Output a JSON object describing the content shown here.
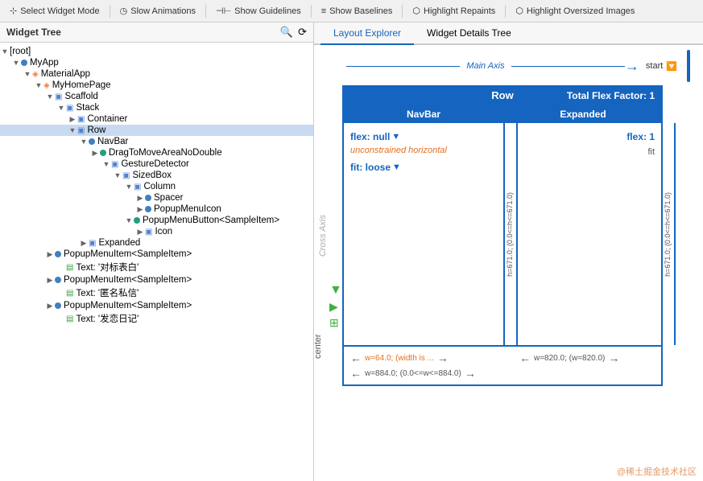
{
  "toolbar": {
    "buttons": [
      {
        "id": "select-widget",
        "icon": "⊹",
        "label": "Select Widget Mode"
      },
      {
        "id": "slow-animations",
        "icon": "◷",
        "label": "Slow Animations"
      },
      {
        "id": "show-guidelines",
        "icon": "⊞",
        "label": "Show Guidelines"
      },
      {
        "id": "show-baselines",
        "icon": "≡",
        "label": "Show Baselines"
      },
      {
        "id": "highlight-repaints",
        "icon": "⬡",
        "label": "Highlight Repaints"
      },
      {
        "id": "highlight-oversized",
        "icon": "⬡",
        "label": "Highlight Oversized Images"
      }
    ]
  },
  "widget_tree": {
    "title": "Widget Tree",
    "search_icon": "🔍",
    "refresh_icon": "⟳",
    "items": [
      {
        "id": "root",
        "label": "[root]",
        "indent": 0,
        "toggle": "▼",
        "icon_type": "none"
      },
      {
        "id": "myapp",
        "label": "MyApp",
        "indent": 1,
        "toggle": "▼",
        "icon_type": "circle-blue"
      },
      {
        "id": "materialapp",
        "label": "MaterialApp",
        "indent": 2,
        "toggle": "▼",
        "icon_type": "material"
      },
      {
        "id": "myhomepage",
        "label": "MyHomePage",
        "indent": 3,
        "toggle": "▼",
        "icon_type": "material"
      },
      {
        "id": "scaffold",
        "label": "Scaffold",
        "indent": 4,
        "toggle": "▼",
        "icon_type": "widget"
      },
      {
        "id": "stack",
        "label": "Stack",
        "indent": 5,
        "toggle": "▼",
        "icon_type": "widget"
      },
      {
        "id": "container",
        "label": "Container",
        "indent": 6,
        "toggle": "▶",
        "icon_type": "widget"
      },
      {
        "id": "row",
        "label": "Row",
        "indent": 6,
        "toggle": "▼",
        "icon_type": "widget",
        "selected": true
      },
      {
        "id": "navbar",
        "label": "NavBar",
        "indent": 7,
        "toggle": "▼",
        "icon_type": "circle-blue"
      },
      {
        "id": "dragtomove",
        "label": "DragToMoveAreaNoDouble",
        "indent": 8,
        "toggle": "▶",
        "icon_type": "circle-teal"
      },
      {
        "id": "gesturedetector",
        "label": "GestureDetector",
        "indent": 9,
        "toggle": "▼",
        "icon_type": "widget"
      },
      {
        "id": "sizedbox",
        "label": "SizedBox",
        "indent": 10,
        "toggle": "▼",
        "icon_type": "widget"
      },
      {
        "id": "column",
        "label": "Column",
        "indent": 11,
        "toggle": "▼",
        "icon_type": "widget"
      },
      {
        "id": "spacer",
        "label": "Spacer",
        "indent": 12,
        "toggle": "▶",
        "icon_type": "circle-blue"
      },
      {
        "id": "popupmenuicon",
        "label": "PopupMenuIcon",
        "indent": 12,
        "toggle": "▶",
        "icon_type": "circle-blue"
      },
      {
        "id": "popupmenubutton",
        "label": "PopupMenuButton<SampleItem>",
        "indent": 11,
        "toggle": "▼",
        "icon_type": "circle-teal"
      },
      {
        "id": "icon",
        "label": "Icon",
        "indent": 12,
        "toggle": "▶",
        "icon_type": "widget"
      },
      {
        "id": "expanded",
        "label": "Expanded",
        "indent": 7,
        "toggle": "▶",
        "icon_type": "widget"
      },
      {
        "id": "popupmenuitem1",
        "label": "PopupMenuItem<SampleItem>",
        "indent": 4,
        "toggle": "▶",
        "icon_type": "circle-blue"
      },
      {
        "id": "text1",
        "label": "Text: '对标表白'",
        "indent": 5,
        "toggle": "",
        "icon_type": "text"
      },
      {
        "id": "popupmenuitem2",
        "label": "PopupMenuItem<SampleItem>",
        "indent": 4,
        "toggle": "▶",
        "icon_type": "circle-blue"
      },
      {
        "id": "text2",
        "label": "Text: '匿名私信'",
        "indent": 5,
        "toggle": "",
        "icon_type": "text"
      },
      {
        "id": "popupmenuitem3",
        "label": "PopupMenuItem<SampleItem>",
        "indent": 4,
        "toggle": "▶",
        "icon_type": "circle-blue"
      },
      {
        "id": "text3",
        "label": "Text: '发恋日记'",
        "indent": 5,
        "toggle": "",
        "icon_type": "text"
      }
    ]
  },
  "layout_explorer": {
    "tab_label": "Layout Explorer",
    "widget_details_tab": "Widget Details Tree",
    "main_axis_label": "Main Axis",
    "main_axis_start": "start",
    "cross_axis_label": "Cross Axis",
    "center_label": "center",
    "row_label": "Row",
    "total_flex_label": "Total Flex Factor: 1",
    "navbar_label": "NavBar",
    "expanded_label": "Expanded",
    "navbar_flex": "flex: null",
    "navbar_unconstrained": "unconstrained horizontal",
    "navbar_fit": "fit: loose",
    "expanded_flex": "flex: 1",
    "expanded_fit": "fit",
    "h_label_navbar": "h=671.0; (0.0<=h<=671.0)",
    "h_label_expanded": "h=671.0; (0.0<=h<=671.0)",
    "w_navbar_bottom": "w=64.0; (width is ...",
    "w_expanded_bottom": "w=820.0; (w=820.0)",
    "w_total_bottom": "w=884.0; (0.0<=w<=884.0)",
    "watermark": "@稀土掘金技术社区"
  }
}
